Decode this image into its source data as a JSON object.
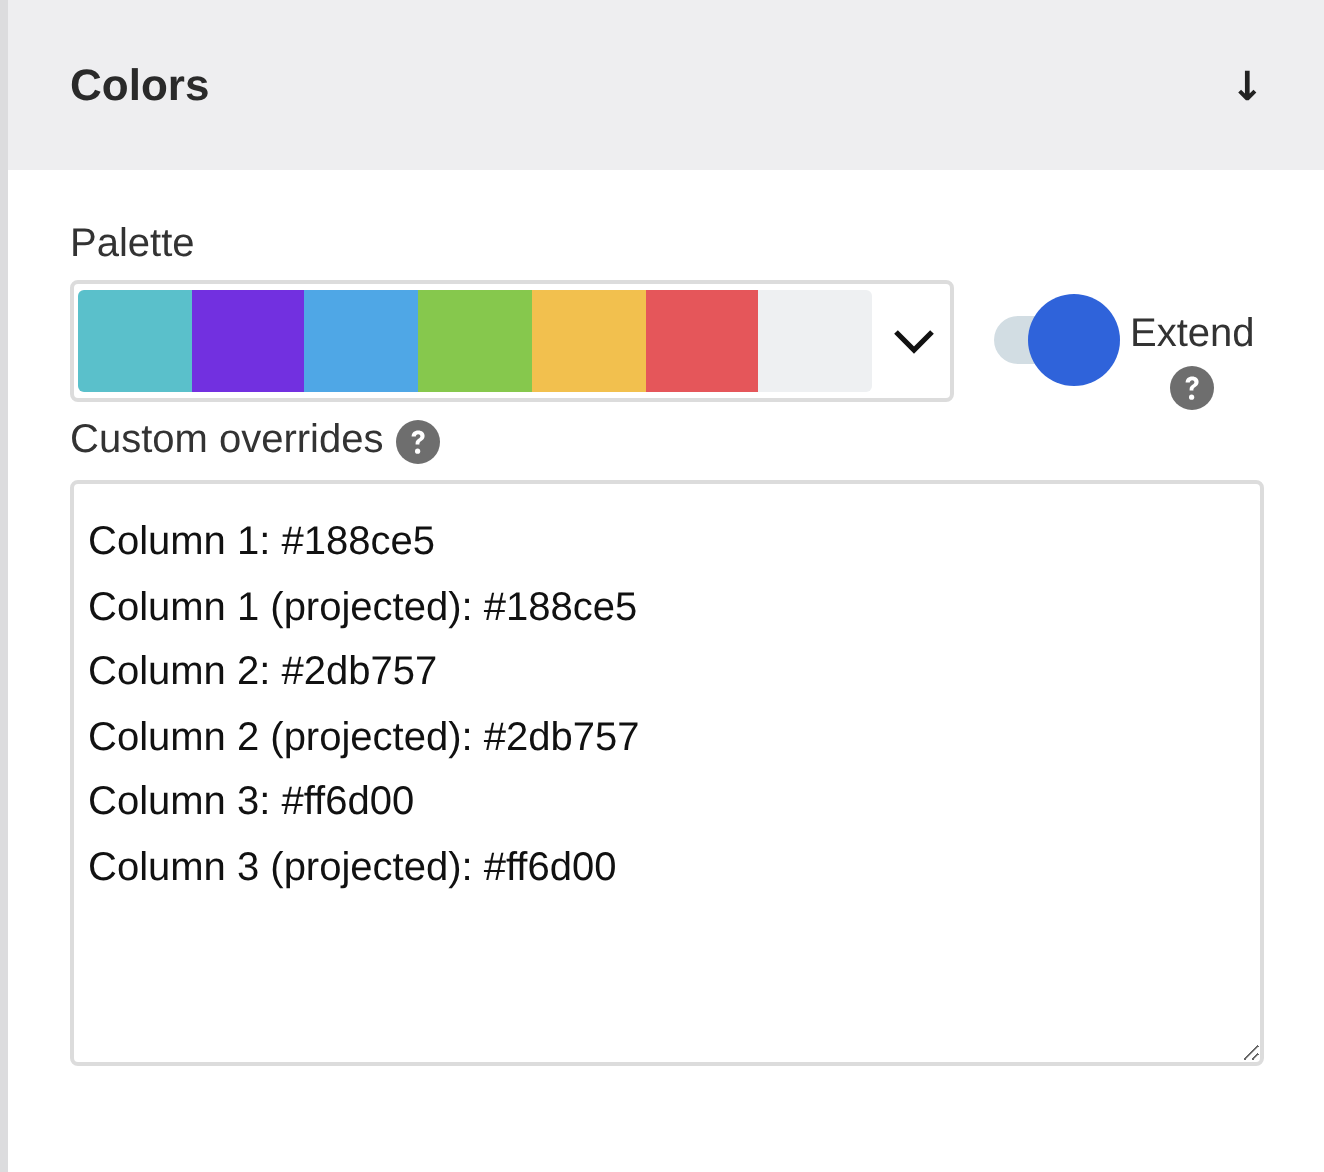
{
  "section": {
    "title": "Colors",
    "toggle_icon": "↓"
  },
  "palette": {
    "label": "Palette",
    "swatches": [
      {
        "color": "#5ac0cb"
      },
      {
        "color": "#7230e0"
      },
      {
        "color": "#4fa7e6"
      },
      {
        "color": "#86c84d"
      },
      {
        "color": "#f2c04e"
      },
      {
        "color": "#e5565a"
      },
      {
        "color": "#eef0f2"
      }
    ]
  },
  "extend": {
    "label": "Extend",
    "on": true
  },
  "overrides": {
    "label": "Custom overrides",
    "lines": [
      "Column 1: #188ce5",
      "Column 1 (projected): #188ce5",
      "Column 2: #2db757",
      "Column 2 (projected): #2db757",
      "Column 3: #ff6d00",
      "Column 3 (projected): #ff6d00"
    ]
  }
}
